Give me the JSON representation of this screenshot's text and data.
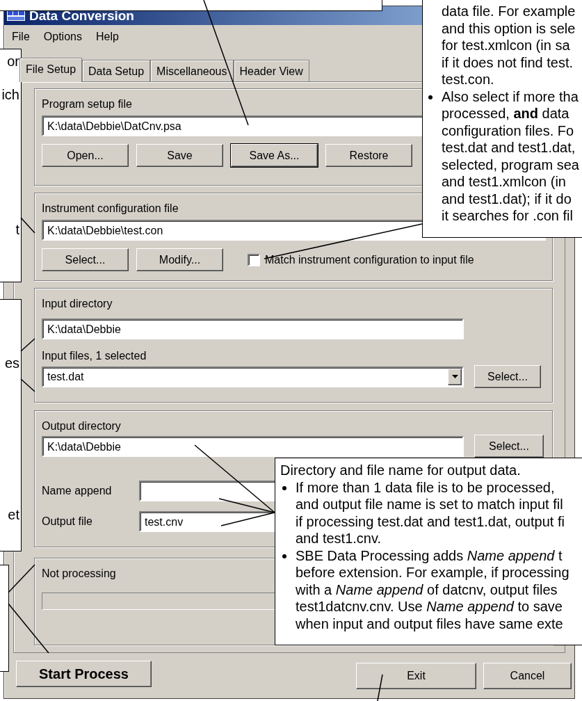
{
  "window": {
    "title": "Data Conversion"
  },
  "menu": [
    "File",
    "Options",
    "Help"
  ],
  "tabs": [
    {
      "label": "File Setup",
      "selected": true
    },
    {
      "label": "Data Setup",
      "selected": false
    },
    {
      "label": "Miscellaneous",
      "selected": false
    },
    {
      "label": "Header View",
      "selected": false
    }
  ],
  "program_setup": {
    "label": "Program setup file",
    "value": "K:\\data\\Debbie\\DatCnv.psa",
    "buttons": [
      {
        "label": "Open...",
        "default": false
      },
      {
        "label": "Save",
        "default": false
      },
      {
        "label": "Save As...",
        "default": true
      },
      {
        "label": "Restore",
        "default": false
      }
    ]
  },
  "instrument_config": {
    "label": "Instrument configuration file",
    "value": "K:\\data\\Debbie\\test.con",
    "buttons": [
      "Select...",
      "Modify..."
    ],
    "match_checkbox": {
      "label": "Match instrument configuration to input file",
      "checked": false
    }
  },
  "input": {
    "directory_label": "Input directory",
    "directory": "K:\\data\\Debbie",
    "files_label": "Input files, 1 selected",
    "files_value": "test.dat",
    "select_button": "Select..."
  },
  "output": {
    "directory_label": "Output directory",
    "directory": "K:\\data\\Debbie",
    "select_button": "Select...",
    "name_append_label": "Name append",
    "output_file_label": "Output file",
    "output_file": "test.cnv"
  },
  "status": {
    "label": "Not processing",
    "level": 0
  },
  "bottom_buttons": [
    {
      "label": "Start Process",
      "kind": "primary"
    },
    {
      "label": "Exit",
      "kind": "normal"
    },
    {
      "label": "Cancel",
      "kind": "normal"
    }
  ],
  "left_callouts": [
    {
      "fragments": [
        "or",
        "ich",
        "t"
      ]
    },
    {
      "fragments": [
        "es",
        "et"
      ]
    }
  ],
  "right_callout": {
    "lines": [
      "data file. For example",
      "and this option is sele",
      "for test.xmlcon (in sa",
      "if it does not find test.",
      "test.con."
    ],
    "bullets": [
      [
        "Also select if more tha",
        "processed, **and** data",
        "configuration files. Fo",
        "test.dat and test1.dat,",
        "selected, program sea",
        "and test1.xmlcon (in",
        "and test1.dat); if it do",
        "it searches for .con fil"
      ]
    ]
  },
  "bottom_callout": {
    "intro": "Directory and file name for output data.",
    "bullets": [
      [
        "If more than 1 data file is to be processed,",
        "and output file name is set to match input fil",
        "if processing test.dat and test1.dat, output fi",
        "and test1.cnv."
      ],
      [
        "SBE Data Processing adds *Name append* t",
        "before extension. For example, if processing",
        "with a *Name append* of datcnv, output files",
        "test1datcnv.cnv. Use *Name append* to save",
        "when input and output files have same exte"
      ]
    ]
  }
}
